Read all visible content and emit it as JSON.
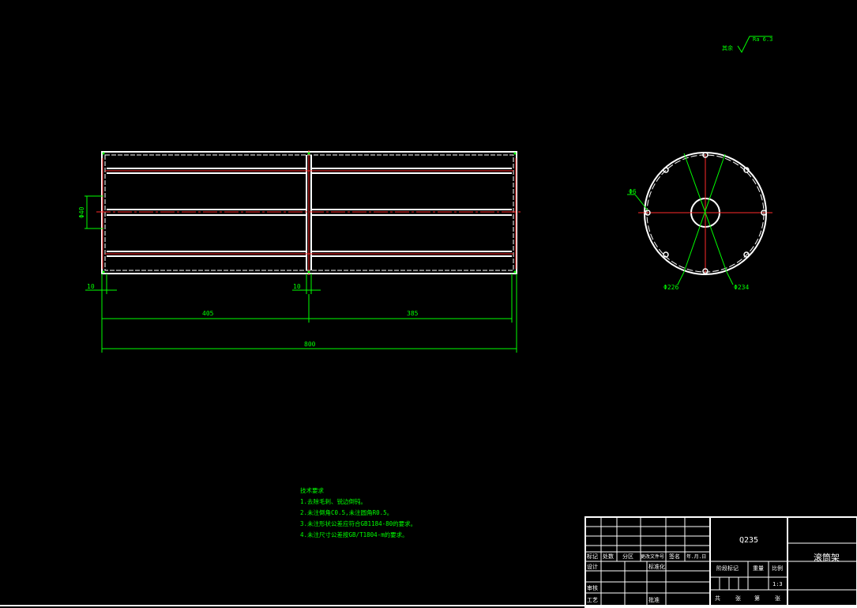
{
  "surface_finish": {
    "prefix": "其余",
    "value": "Ra 6.3"
  },
  "front_view": {
    "dim_height": "Φ40",
    "dim_left_end": "10",
    "dim_mid": "10",
    "dim_left_section": "405",
    "dim_right_section": "385",
    "dim_total": "800"
  },
  "side_view": {
    "dim_hole": "Φ6",
    "dim_inner": "Φ226",
    "dim_outer": "Φ234"
  },
  "technical_notes": {
    "title": "技术要求",
    "items": [
      "1.去除毛刺、锐边倒钝。",
      "2.未注倒角C0.5,未注圆角R0.5。",
      "3.未注形状公差应符合GB1184-80的要求。",
      "4.未注尺寸公差按GB/T1804-m的要求。"
    ]
  },
  "title_block": {
    "material": "Q235",
    "part_name": "滚筒架",
    "scale_value": "1:3",
    "labels": {
      "mark": "标记",
      "count": "处数",
      "zone": "分区",
      "change_doc": "更改文件号",
      "signature": "签名",
      "date": "年.月.日",
      "design": "设计",
      "standardize": "标准化",
      "review": "审核",
      "process": "工艺",
      "approve": "批准",
      "stage_mark": "阶段标记",
      "weight": "重量",
      "scale": "比例",
      "total": "共",
      "sheet": "张",
      "page": "第",
      "sheet2": "张"
    }
  }
}
